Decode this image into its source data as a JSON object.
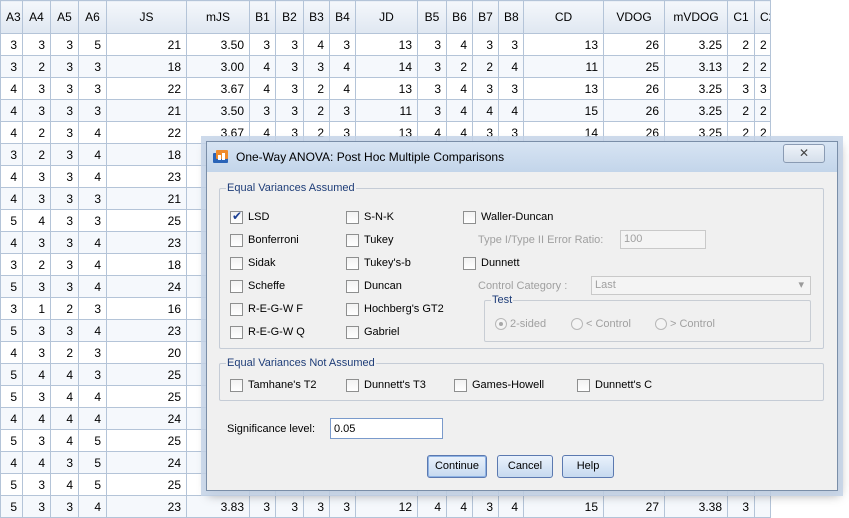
{
  "grid": {
    "columns": [
      {
        "label": "A3",
        "w": 22
      },
      {
        "label": "A4",
        "w": 28
      },
      {
        "label": "A5",
        "w": 28
      },
      {
        "label": "A6",
        "w": 28
      },
      {
        "label": "JS",
        "w": 80
      },
      {
        "label": "mJS",
        "w": 63
      },
      {
        "label": "B1",
        "w": 26
      },
      {
        "label": "B2",
        "w": 28
      },
      {
        "label": "B3",
        "w": 26
      },
      {
        "label": "B4",
        "w": 26
      },
      {
        "label": "JD",
        "w": 62
      },
      {
        "label": "B5",
        "w": 29
      },
      {
        "label": "B6",
        "w": 26
      },
      {
        "label": "B7",
        "w": 26
      },
      {
        "label": "B8",
        "w": 25
      },
      {
        "label": "CD",
        "w": 80
      },
      {
        "label": "VDOG",
        "w": 61
      },
      {
        "label": "mVDOG",
        "w": 63
      },
      {
        "label": "C1",
        "w": 27
      },
      {
        "label": "C2",
        "w": 16
      }
    ],
    "rows": [
      [
        "3",
        "3",
        "3",
        "5",
        "21",
        "3.50",
        "3",
        "3",
        "4",
        "3",
        "13",
        "3",
        "4",
        "3",
        "3",
        "13",
        "26",
        "3.25",
        "2",
        "2"
      ],
      [
        "3",
        "2",
        "3",
        "3",
        "18",
        "3.00",
        "4",
        "3",
        "3",
        "4",
        "14",
        "3",
        "2",
        "2",
        "4",
        "11",
        "25",
        "3.13",
        "2",
        "2"
      ],
      [
        "4",
        "3",
        "3",
        "3",
        "22",
        "3.67",
        "4",
        "3",
        "2",
        "4",
        "13",
        "3",
        "4",
        "3",
        "3",
        "13",
        "26",
        "3.25",
        "3",
        "3"
      ],
      [
        "4",
        "3",
        "3",
        "3",
        "21",
        "3.50",
        "3",
        "3",
        "2",
        "3",
        "11",
        "3",
        "4",
        "4",
        "4",
        "15",
        "26",
        "3.25",
        "2",
        "2"
      ],
      [
        "4",
        "2",
        "3",
        "4",
        "22",
        "3.67",
        "4",
        "3",
        "2",
        "3",
        "13",
        "4",
        "4",
        "3",
        "3",
        "14",
        "26",
        "3.25",
        "2",
        "2"
      ],
      [
        "3",
        "2",
        "3",
        "4",
        "18",
        "",
        "",
        "",
        "",
        "",
        "",
        "",
        "",
        "",
        "",
        "",
        "",
        "",
        "",
        ""
      ],
      [
        "4",
        "3",
        "3",
        "4",
        "23",
        "",
        "",
        "",
        "",
        "",
        "",
        "",
        "",
        "",
        "",
        "",
        "",
        "",
        "",
        ""
      ],
      [
        "4",
        "3",
        "3",
        "3",
        "21",
        "",
        "",
        "",
        "",
        "",
        "",
        "",
        "",
        "",
        "",
        "",
        "",
        "",
        "",
        ""
      ],
      [
        "5",
        "4",
        "3",
        "3",
        "25",
        "",
        "",
        "",
        "",
        "",
        "",
        "",
        "",
        "",
        "",
        "",
        "",
        "",
        "",
        ""
      ],
      [
        "4",
        "3",
        "3",
        "4",
        "23",
        "",
        "",
        "",
        "",
        "",
        "",
        "",
        "",
        "",
        "",
        "",
        "",
        "",
        "",
        ""
      ],
      [
        "3",
        "2",
        "3",
        "4",
        "18",
        "",
        "",
        "",
        "",
        "",
        "",
        "",
        "",
        "",
        "",
        "",
        "",
        "",
        "",
        ""
      ],
      [
        "5",
        "3",
        "3",
        "4",
        "24",
        "",
        "",
        "",
        "",
        "",
        "",
        "",
        "",
        "",
        "",
        "",
        "",
        "",
        "",
        ""
      ],
      [
        "3",
        "1",
        "2",
        "3",
        "16",
        "",
        "",
        "",
        "",
        "",
        "",
        "",
        "",
        "",
        "",
        "",
        "",
        "",
        "",
        ""
      ],
      [
        "5",
        "3",
        "3",
        "4",
        "23",
        "",
        "",
        "",
        "",
        "",
        "",
        "",
        "",
        "",
        "",
        "",
        "",
        "",
        "",
        ""
      ],
      [
        "4",
        "3",
        "2",
        "3",
        "20",
        "",
        "",
        "",
        "",
        "",
        "",
        "",
        "",
        "",
        "",
        "",
        "",
        "",
        "",
        ""
      ],
      [
        "5",
        "4",
        "4",
        "3",
        "25",
        "",
        "",
        "",
        "",
        "",
        "",
        "",
        "",
        "",
        "",
        "",
        "",
        "",
        "",
        ""
      ],
      [
        "5",
        "3",
        "4",
        "4",
        "25",
        "",
        "",
        "",
        "",
        "",
        "",
        "",
        "",
        "",
        "",
        "",
        "",
        "",
        "",
        ""
      ],
      [
        "4",
        "4",
        "4",
        "4",
        "24",
        "",
        "",
        "",
        "",
        "",
        "",
        "",
        "",
        "",
        "",
        "",
        "",
        "",
        "",
        ""
      ],
      [
        "5",
        "3",
        "4",
        "5",
        "25",
        "",
        "",
        "",
        "",
        "",
        "",
        "",
        "",
        "",
        "",
        "",
        "",
        "",
        "",
        ""
      ],
      [
        "4",
        "4",
        "3",
        "5",
        "24",
        "",
        "",
        "",
        "",
        "",
        "",
        "",
        "",
        "",
        "",
        "",
        "",
        "",
        "",
        ""
      ],
      [
        "5",
        "3",
        "4",
        "5",
        "25",
        "",
        "",
        "",
        "",
        "",
        "",
        "",
        "",
        "",
        "",
        "",
        "",
        "",
        "",
        ""
      ],
      [
        "5",
        "3",
        "3",
        "4",
        "23",
        "3.83",
        "3",
        "3",
        "3",
        "3",
        "12",
        "4",
        "4",
        "3",
        "4",
        "15",
        "27",
        "3.38",
        "3",
        ""
      ]
    ]
  },
  "dialog": {
    "title": "One-Way ANOVA: Post Hoc Multiple Comparisons",
    "close_glyph": "✕",
    "assumed": {
      "legend": "Equal Variances Assumed",
      "lsd": "LSD",
      "bonferroni": "Bonferroni",
      "sidak": "Sidak",
      "scheffe": "Scheffe",
      "regwf": "R-E-G-W F",
      "regwq": "R-E-G-W Q",
      "snk": "S-N-K",
      "tukey": "Tukey",
      "tukeysb": "Tukey's-b",
      "duncan": "Duncan",
      "hochberg": "Hochberg's GT2",
      "gabriel": "Gabriel",
      "waller": "Waller-Duncan",
      "ratio_label": "Type I/Type II Error Ratio:",
      "ratio_value": "100",
      "dunnett": "Dunnett",
      "control_label": "Control Category :",
      "control_value": "Last",
      "test_legend": "Test",
      "two_sided": "2-sided",
      "less_control": "< Control",
      "greater_control": "> Control"
    },
    "not_assumed": {
      "legend": "Equal Variances Not Assumed",
      "tamhane": "Tamhane's T2",
      "dunnett_t3": "Dunnett's T3",
      "games_howell": "Games-Howell",
      "dunnett_c": "Dunnett's C"
    },
    "significance": {
      "label": "Significance level:",
      "value": "0.05"
    },
    "buttons": {
      "continue": "Continue",
      "cancel": "Cancel",
      "help": "Help"
    }
  }
}
